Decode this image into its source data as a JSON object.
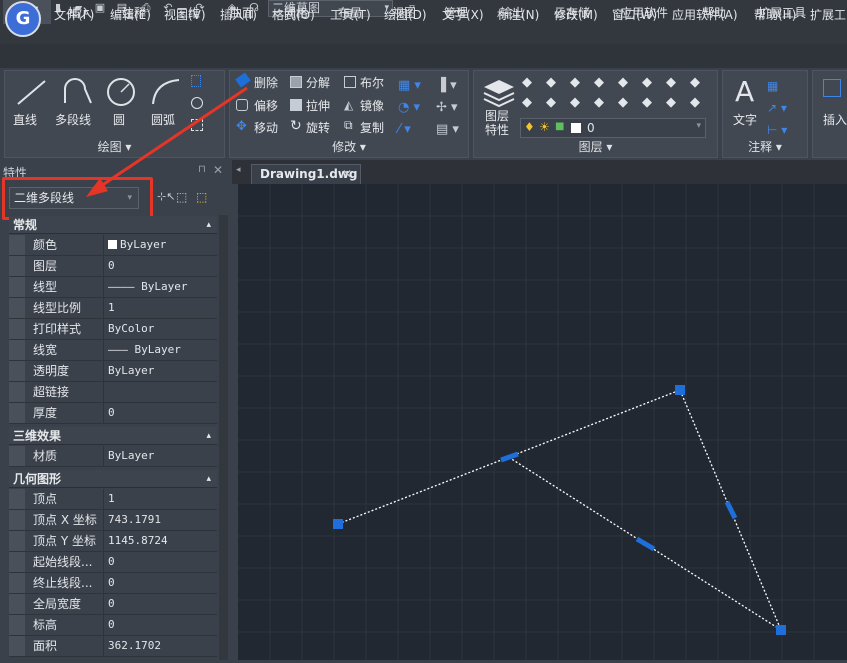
{
  "app": {
    "logo_letter": "G",
    "workspace": "二维草图"
  },
  "menu": [
    "文件(F)",
    "编辑(E)",
    "视图(V)",
    "插入(I)",
    "格式(O)",
    "工具(T)",
    "绘图(D)",
    "文字(X)",
    "标注(N)",
    "修改(M)",
    "窗口(W)",
    "应用软件(A)",
    "帮助(H)",
    "扩展工"
  ],
  "tabs": [
    "常用",
    "插入",
    "注释",
    "三维",
    "曲面",
    "网格",
    "布局",
    "视图",
    "管理",
    "输出",
    "云存储",
    "应用软件",
    "帮助",
    "扩展工具"
  ],
  "ribbon": {
    "draw": {
      "title": "绘图",
      "buttons": [
        "直线",
        "多段线",
        "圆",
        "圆弧"
      ]
    },
    "modify": {
      "title": "修改",
      "buttons": [
        "删除",
        "分解",
        "布尔",
        "偏移",
        "拉伸",
        "镜像",
        "移动",
        "旋转",
        "复制"
      ]
    },
    "layer": {
      "title": "图层",
      "button": "图层\n特性",
      "current_layer": "0"
    },
    "annot": {
      "title": "注释",
      "button": "文字"
    },
    "insert": {
      "button": "插入"
    }
  },
  "properties": {
    "title": "特性",
    "selected": "二维多段线",
    "sections": [
      {
        "name": "常规",
        "rows": [
          [
            "颜色",
            "ByLayer"
          ],
          [
            "图层",
            "0"
          ],
          [
            "线型",
            "———— ByLayer"
          ],
          [
            "线型比例",
            "1"
          ],
          [
            "打印样式",
            "ByColor"
          ],
          [
            "线宽",
            "——— ByLayer"
          ],
          [
            "透明度",
            "ByLayer"
          ],
          [
            "超链接",
            ""
          ],
          [
            "厚度",
            "0"
          ]
        ]
      },
      {
        "name": "三维效果",
        "rows": [
          [
            "材质",
            "ByLayer"
          ]
        ]
      },
      {
        "name": "几何图形",
        "rows": [
          [
            "顶点",
            "1"
          ],
          [
            "顶点 X 坐标",
            "743.1791"
          ],
          [
            "顶点 Y 坐标",
            "1145.8724"
          ],
          [
            "起始线段...",
            "0"
          ],
          [
            "终止线段...",
            "0"
          ],
          [
            "全局宽度",
            "0"
          ],
          [
            "标高",
            "0"
          ],
          [
            "面积",
            "362.1702"
          ]
        ]
      }
    ]
  },
  "document": {
    "tab": "Drawing1.dwg"
  },
  "colors": {
    "accent": "#1e6fd9",
    "annotation": "#e63527",
    "canvas": "#222832"
  }
}
